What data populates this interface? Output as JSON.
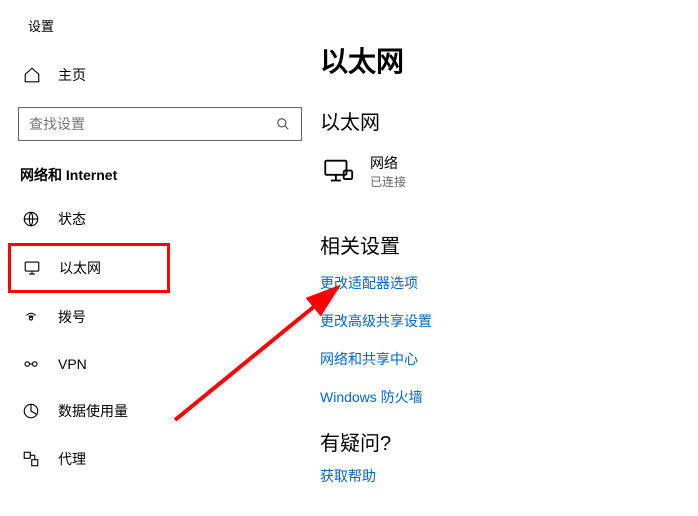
{
  "app_title": "设置",
  "home": {
    "label": "主页"
  },
  "search": {
    "placeholder": "查找设置"
  },
  "category": "网络和 Internet",
  "nav": [
    {
      "label": "状态"
    },
    {
      "label": "以太网"
    },
    {
      "label": "拨号"
    },
    {
      "label": "VPN"
    },
    {
      "label": "数据使用量"
    },
    {
      "label": "代理"
    }
  ],
  "main": {
    "title": "以太网",
    "subtitle": "以太网",
    "network": {
      "name": "网络",
      "status": "已连接"
    },
    "related_title": "相关设置",
    "links": [
      "更改适配器选项",
      "更改高级共享设置",
      "网络和共享中心",
      "Windows 防火墙"
    ],
    "question_title": "有疑问?",
    "help_link": "获取帮助"
  }
}
